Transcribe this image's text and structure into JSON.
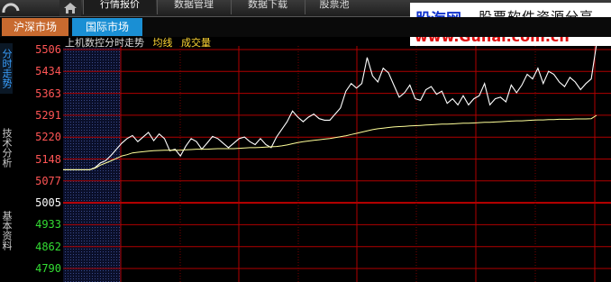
{
  "nav": {
    "tabs": [
      {
        "label": "行情报价",
        "active": true
      },
      {
        "label": "数据管理",
        "active": false
      },
      {
        "label": "数据下载",
        "active": false
      },
      {
        "label": "股票池",
        "active": false
      }
    ]
  },
  "market_tabs": [
    "沪深市场",
    "国际市场"
  ],
  "side_tabs": [
    "分时走势",
    "技术分析",
    "基本资料"
  ],
  "watermark": {
    "brand": "股海网",
    "slogan": "股票软件资源分享",
    "url": "www.Guhai.com.cn"
  },
  "chart_title": {
    "name": "上机数控分时走势",
    "avg_label": "均线",
    "vol_label": "成交量"
  },
  "colors": {
    "up": "#ff5555",
    "down": "#33dd33",
    "flat": "#ffffff",
    "grid": "#b00000",
    "price": "#ffffff",
    "avg": "#ffff99"
  },
  "chart_data": {
    "type": "line",
    "y_ticks": [
      {
        "label": "5506",
        "dir": "up"
      },
      {
        "label": "5434",
        "dir": "up"
      },
      {
        "label": "5363",
        "dir": "up"
      },
      {
        "label": "5291",
        "dir": "up"
      },
      {
        "label": "5220",
        "dir": "up"
      },
      {
        "label": "5148",
        "dir": "up"
      },
      {
        "label": "5077",
        "dir": "up"
      },
      {
        "label": "5005",
        "dir": "flat"
      },
      {
        "label": "4933",
        "dir": "down"
      },
      {
        "label": "4862",
        "dir": "down"
      },
      {
        "label": "4790",
        "dir": "down"
      }
    ],
    "ylim": [
      4790,
      5506
    ],
    "series": [
      {
        "key": "price",
        "values": [
          5113,
          5113,
          5113,
          5113,
          5113,
          5113,
          5120,
          5135,
          5143,
          5160,
          5180,
          5200,
          5215,
          5225,
          5205,
          5220,
          5235,
          5208,
          5230,
          5215,
          5175,
          5180,
          5158,
          5190,
          5215,
          5205,
          5180,
          5200,
          5222,
          5215,
          5200,
          5185,
          5200,
          5215,
          5220,
          5205,
          5195,
          5215,
          5195,
          5185,
          5220,
          5245,
          5270,
          5305,
          5285,
          5270,
          5285,
          5295,
          5280,
          5275,
          5275,
          5295,
          5315,
          5370,
          5395,
          5380,
          5395,
          5480,
          5420,
          5400,
          5445,
          5430,
          5390,
          5350,
          5365,
          5390,
          5345,
          5340,
          5375,
          5385,
          5360,
          5370,
          5330,
          5345,
          5325,
          5355,
          5325,
          5345,
          5355,
          5395,
          5325,
          5345,
          5350,
          5335,
          5390,
          5365,
          5390,
          5425,
          5410,
          5445,
          5395,
          5435,
          5425,
          5400,
          5385,
          5415,
          5400,
          5375,
          5395,
          5410,
          5525
        ]
      },
      {
        "key": "avg",
        "values": [
          5113,
          5113,
          5113,
          5113,
          5113,
          5113,
          5118,
          5128,
          5135,
          5142,
          5150,
          5158,
          5162,
          5168,
          5170,
          5172,
          5174,
          5175,
          5176,
          5177,
          5177,
          5177,
          5177,
          5178,
          5179,
          5180,
          5180,
          5180,
          5181,
          5182,
          5182,
          5182,
          5182,
          5183,
          5184,
          5185,
          5185,
          5186,
          5187,
          5188,
          5189,
          5191,
          5194,
          5198,
          5202,
          5205,
          5207,
          5209,
          5211,
          5213,
          5215,
          5218,
          5221,
          5224,
          5228,
          5232,
          5236,
          5240,
          5244,
          5247,
          5249,
          5251,
          5253,
          5254,
          5255,
          5256,
          5257,
          5258,
          5259,
          5260,
          5261,
          5262,
          5262,
          5263,
          5264,
          5265,
          5265,
          5266,
          5267,
          5268,
          5268,
          5269,
          5270,
          5271,
          5272,
          5273,
          5273,
          5274,
          5275,
          5276,
          5276,
          5277,
          5277,
          5278,
          5278,
          5278,
          5279,
          5279,
          5279,
          5280,
          5291
        ]
      }
    ]
  }
}
